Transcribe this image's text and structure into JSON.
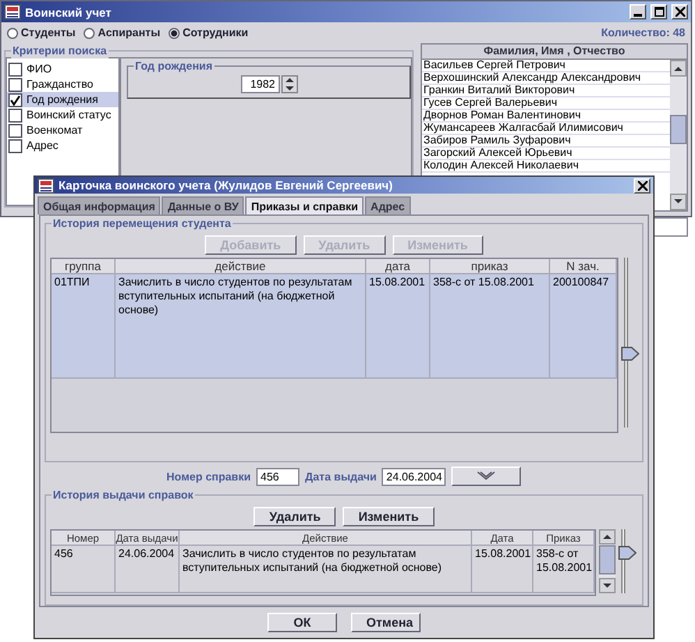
{
  "window": {
    "title": "Воинский учет",
    "radios": [
      {
        "label": "Студенты",
        "selected": false
      },
      {
        "label": "Аспиранты",
        "selected": false
      },
      {
        "label": "Сотрудники",
        "selected": true
      }
    ],
    "count": "Количество: 48",
    "criteria": {
      "title": "Критерии поиска",
      "items": [
        {
          "label": "ФИО",
          "checked": false,
          "selected": false
        },
        {
          "label": "Гражданство",
          "checked": false,
          "selected": false
        },
        {
          "label": "Год рождения",
          "checked": true,
          "selected": true
        },
        {
          "label": "Воинский статус",
          "checked": false,
          "selected": false
        },
        {
          "label": "Военкомат",
          "checked": false,
          "selected": false
        },
        {
          "label": "Адрес",
          "checked": false,
          "selected": false
        }
      ],
      "year_group": {
        "title": "Год рождения",
        "value": "1982"
      }
    },
    "people": {
      "header": "Фамилия, Имя , Отчество",
      "rows": [
        "Васильев Сергей Петрович",
        "Верхошинский Александр Александрович",
        "Гранкин Виталий Викторович",
        "Гусев Сергей Валерьевич",
        "Дворнов Роман Валентинович",
        "Жумансареев Жалгасбай Илимисович",
        "Забиров Рамиль Зуфарович",
        "Загорский Алексей Юрьевич",
        "Колодин Алексей Николаевич"
      ]
    }
  },
  "dialog": {
    "title": "Карточка воинского учета (Жулидов Евгений Сергеевич)",
    "tabs": [
      {
        "label": "Общая информация",
        "selected": false
      },
      {
        "label": "Данные о ВУ",
        "selected": false
      },
      {
        "label": "Приказы и справки",
        "selected": true
      },
      {
        "label": "Адрес",
        "selected": false
      }
    ],
    "movement": {
      "title": "История перемещения студента",
      "buttons": [
        {
          "label": "Добавить",
          "disabled": true
        },
        {
          "label": "Удалить",
          "disabled": true
        },
        {
          "label": "Изменить",
          "disabled": true
        }
      ],
      "columns": [
        "группа",
        "действие",
        "дата",
        "приказ",
        "N зач."
      ],
      "rows": [
        {
          "cells": [
            "01ТПИ",
            "Зачислить в число студентов по результатам вступительных испытаний (на бюджетной основе)",
            "15.08.2001",
            "358-с от 15.08.2001",
            "200100847"
          ],
          "selected": true
        }
      ],
      "slider": {
        "level": 0.43
      }
    },
    "form": {
      "number_label": "Номер справки",
      "number": "456",
      "date_label": "Дата выдачи",
      "date": "24.06.2004"
    },
    "certificates": {
      "title": "История выдачи справок",
      "buttons": [
        {
          "label": "Удалить",
          "disabled": false
        },
        {
          "label": "Изменить",
          "disabled": false
        }
      ],
      "columns": [
        "Номер",
        "Дата выдачи",
        "Действие",
        "Дата",
        "Приказ"
      ],
      "rows": [
        {
          "cells": [
            "456",
            "24.06.2004",
            "Зачислить в число студентов по результатам вступительных испытаний (на бюджетной основе)",
            "15.08.2001",
            "358-с от 15.08.2001"
          ],
          "selected": false
        }
      ],
      "slider": {
        "level": 0.67
      }
    },
    "footer_buttons": [
      "ОК",
      "Отмена"
    ]
  }
}
